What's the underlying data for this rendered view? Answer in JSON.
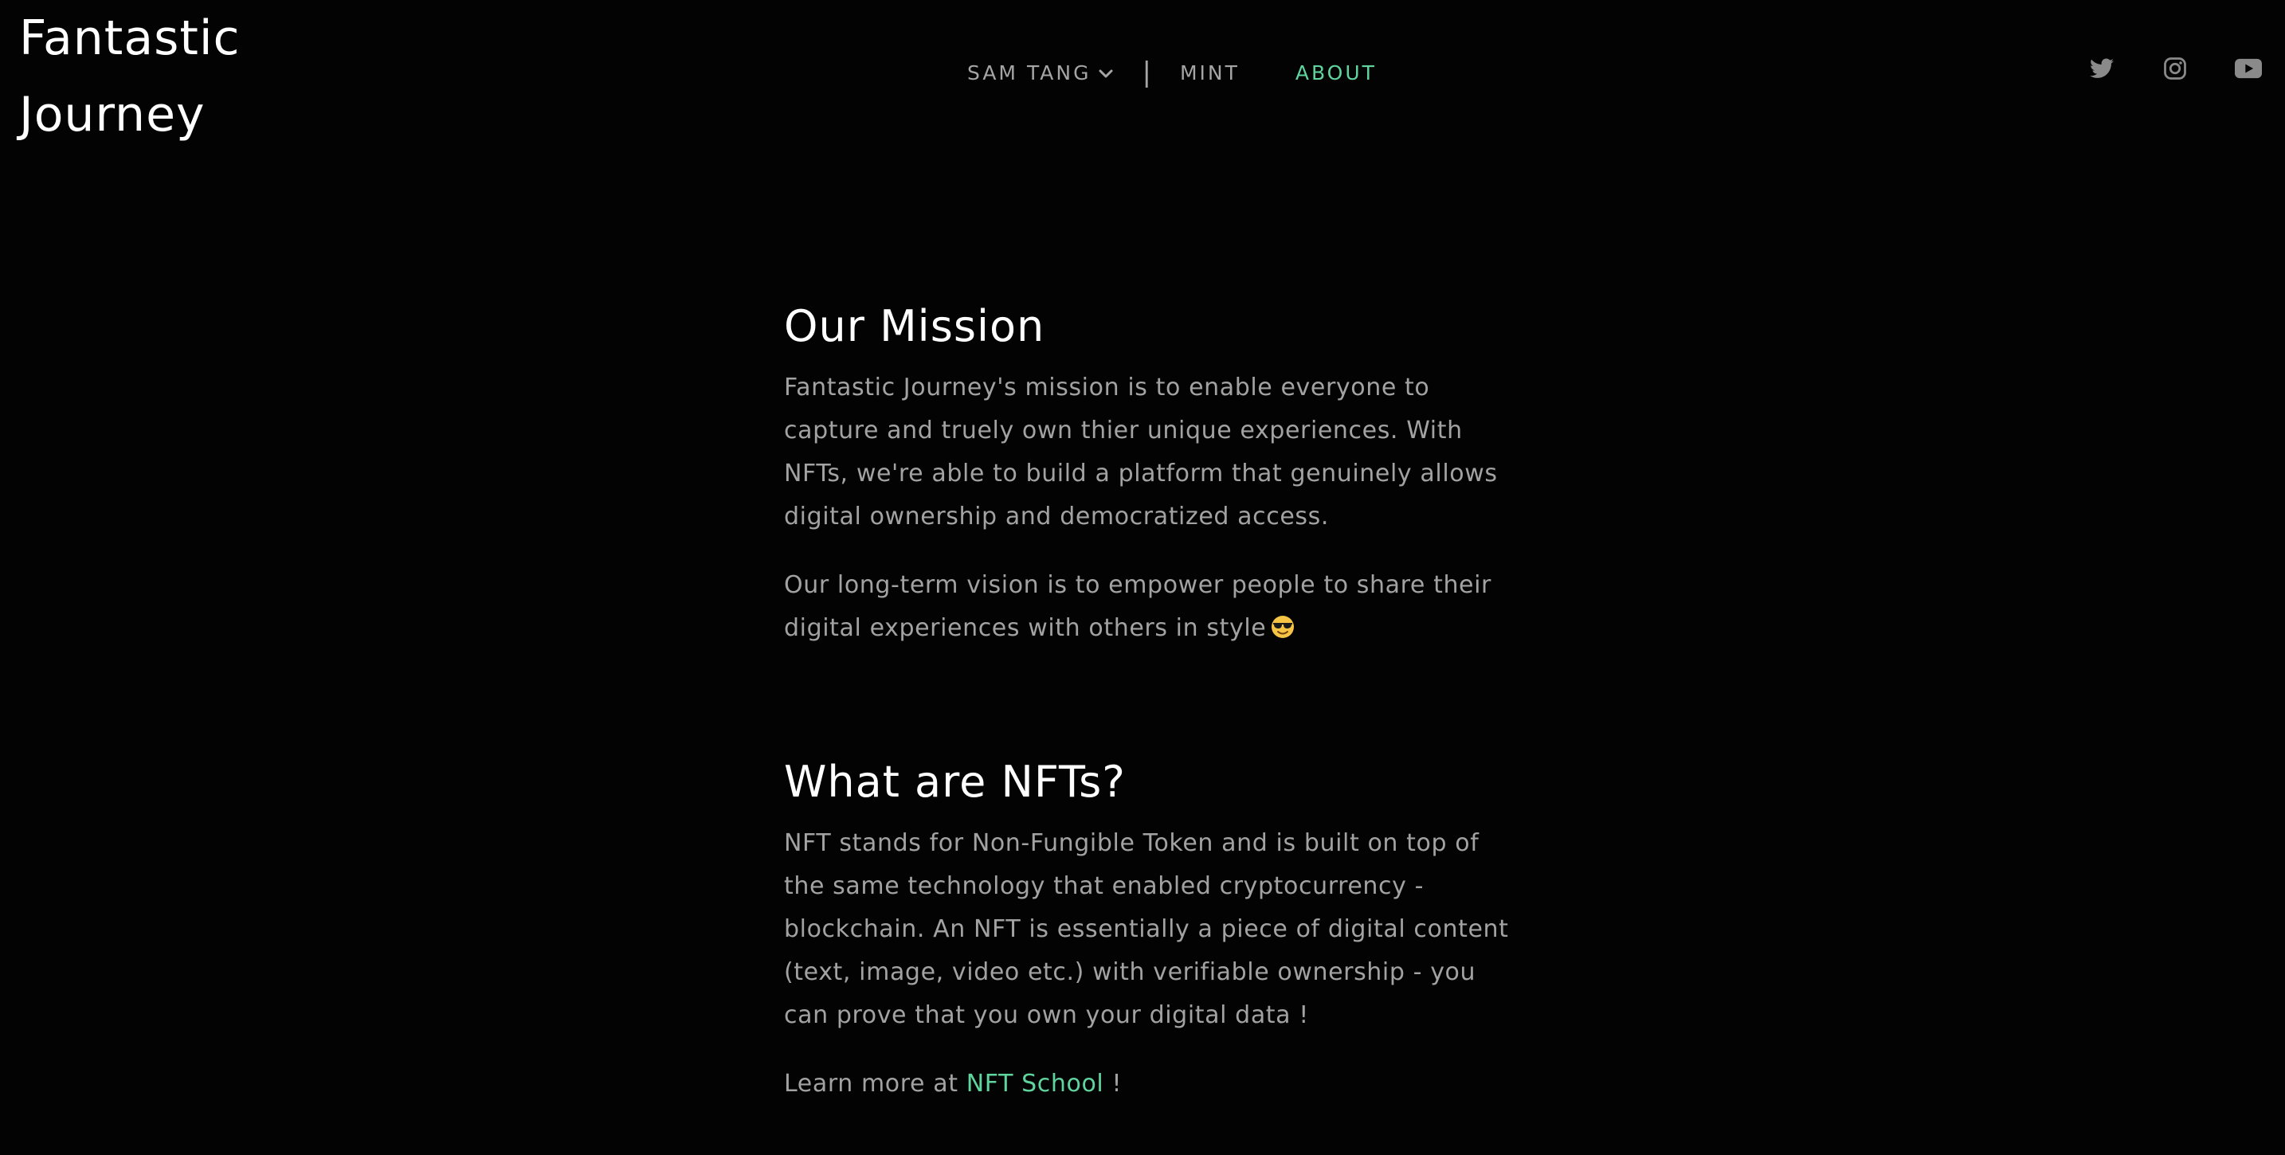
{
  "header": {
    "logo_line1": "Fantastic",
    "logo_line2": "Journey",
    "nav": {
      "dropdown_label": "SAM TANG",
      "separator": "|",
      "mint_label": "MINT",
      "about_label": "ABOUT"
    },
    "social": [
      "twitter-icon",
      "instagram-icon",
      "youtube-icon"
    ]
  },
  "mission": {
    "title": "Our Mission",
    "p1": "Fantastic Journey's mission is to enable everyone to capture and truely own thier unique experiences. With NFTs, we're able to build a platform that genuinely allows digital ownership and democratized access.",
    "p2": "Our long-term vision is to empower people to share their digital experiences with others in style"
  },
  "nfts": {
    "title": "What are NFTs?",
    "p1": "NFT stands for Non-Fungible Token and is built on top of the same technology that enabled cryptocurrency - blockchain. An NFT is essentially a piece of digital content (text, image, video etc.) with verifiable ownership - you can prove that you own your digital data !",
    "learn_prefix": "Learn more at",
    "learn_link": "NFT School",
    "learn_suffix": "!"
  },
  "colors": {
    "background": "#030303",
    "accent": "#5fd49e",
    "body_text": "#a2a2a2",
    "heading": "#ffffff"
  }
}
